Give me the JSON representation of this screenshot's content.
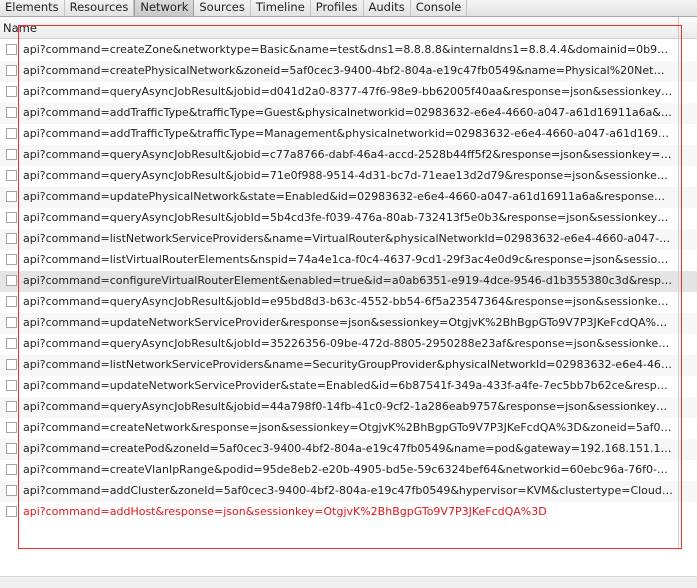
{
  "tabs": [
    {
      "label": "Elements"
    },
    {
      "label": "Resources"
    },
    {
      "label": "Network"
    },
    {
      "label": "Sources"
    },
    {
      "label": "Timeline"
    },
    {
      "label": "Profiles"
    },
    {
      "label": "Audits"
    },
    {
      "label": "Console"
    }
  ],
  "active_tab": "Network",
  "table": {
    "column_name": "Name",
    "rows": [
      {
        "url": "api?command=createZone&networktype=Basic&name=test&dns1=8.8.8.8&internaldns1=8.8.4.4&domainid=0b9ca826..."
      },
      {
        "url": "api?command=createPhysicalNetwork&zoneid=5af0cec3-9400-4bf2-804a-e19c47fb0549&name=Physical%20Network..."
      },
      {
        "url": "api?command=queryAsyncJobResult&jobid=d041d2a0-8377-47f6-98e9-bb62005f40aa&response=json&sessionkey=Ot..."
      },
      {
        "url": "api?command=addTrafficType&trafficType=Guest&physicalnetworkid=02983632-e6e4-4660-a047-a61d16911a6a&respo..."
      },
      {
        "url": "api?command=addTrafficType&trafficType=Management&physicalnetworkid=02983632-e6e4-4660-a047-a61d16911a6..."
      },
      {
        "url": "api?command=queryAsyncJobResult&jobid=c77a8766-dabf-46a4-accd-2528b44ff5f2&response=json&sessionkey=Otg..."
      },
      {
        "url": "api?command=queryAsyncJobResult&jobid=71e0f988-9514-4d31-bc7d-71eae13d2d79&response=json&sessionkey=Ot..."
      },
      {
        "url": "api?command=updatePhysicalNetwork&state=Enabled&id=02983632-e6e4-4660-a047-a61d16911a6a&response=json..."
      },
      {
        "url": "api?command=queryAsyncJobResult&jobId=5b4cd3fe-f039-476a-80ab-732413f5e0b3&response=json&sessionkey=Ot..."
      },
      {
        "url": "api?command=listNetworkServiceProviders&name=VirtualRouter&physicalNetworkId=02983632-e6e4-4660-a047-a61d..."
      },
      {
        "url": "api?command=listVirtualRouterElements&nspid=74a4e1ca-f0c4-4637-9cd1-29f3ac4e0d9c&response=json&sessionke..."
      },
      {
        "url": "api?command=configureVirtualRouterElement&enabled=true&id=a0ab6351-e919-4dce-9546-d1b355380c3d&response..."
      },
      {
        "url": "api?command=queryAsyncJobResult&jobId=e95bd8d3-b63c-4552-bb54-6f5a23547364&response=json&sessionkey=Ot..."
      },
      {
        "url": "api?command=updateNetworkServiceProvider&response=json&sessionkey=OtgjvK%2BhBgpGTo9V7P3JKeFcdQA%3D..."
      },
      {
        "url": "api?command=queryAsyncJobResult&jobId=35226356-09be-472d-8805-2950288e23af&response=json&sessionkey=Ot..."
      },
      {
        "url": "api?command=listNetworkServiceProviders&name=SecurityGroupProvider&physicalNetworkId=02983632-e6e4-4660-a..."
      },
      {
        "url": "api?command=updateNetworkServiceProvider&state=Enabled&id=6b87541f-349a-433f-a4fe-7ec5bb7b62ce&response..."
      },
      {
        "url": "api?command=queryAsyncJobResult&jobid=44a798f0-14fb-41c0-9cf2-1a286eab9757&response=json&sessionkey=Ot..."
      },
      {
        "url": "api?command=createNetwork&response=json&sessionkey=OtgjvK%2BhBgpGTo9V7P3JKeFcdQA%3D&zoneid=5af0ce..."
      },
      {
        "url": "api?command=createPod&zoneId=5af0cec3-9400-4bf2-804a-e19c47fb0549&name=pod&gateway=192.168.151.1&net..."
      },
      {
        "url": "api?command=createVlanIpRange&podid=95de8eb2-e20b-4905-bd5e-59c6324bef64&networkid=60ebc96a-76f0-46f7-..."
      },
      {
        "url": "api?command=addCluster&zoneId=5af0cec3-9400-4bf2-804a-e19c47fb0549&hypervisor=KVM&clustertype=CloudMa..."
      },
      {
        "url": "api?command=addHost&response=json&sessionkey=OtgjvK%2BhBgpGTo9V7P3JKeFcdQA%3D"
      }
    ]
  },
  "colors": {
    "error_text": "#e0161b",
    "highlight_box": "#ff2a2a",
    "selected_row": "#e4e4e4"
  }
}
